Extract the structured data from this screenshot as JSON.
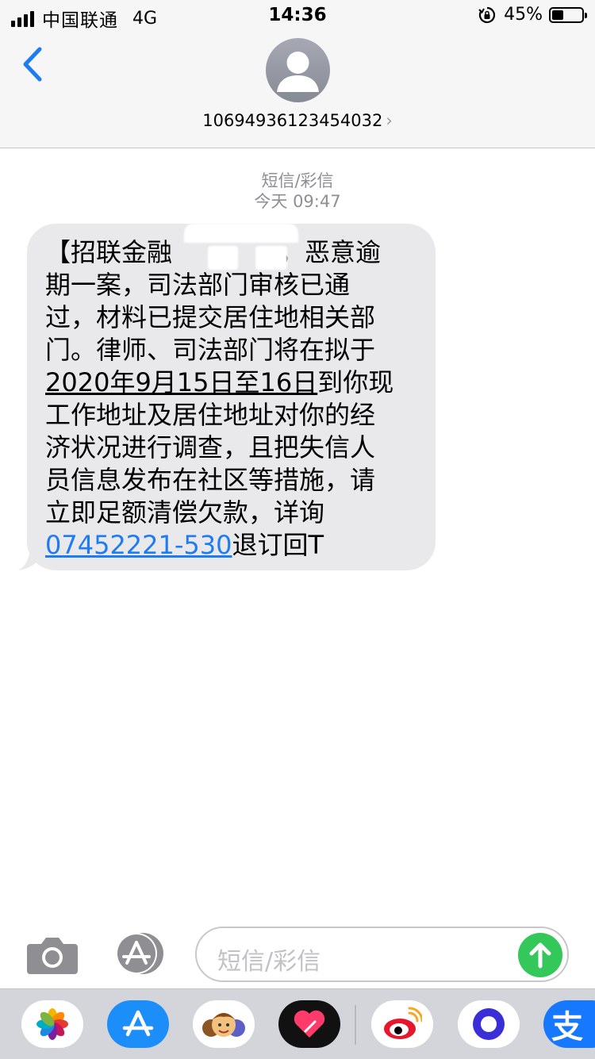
{
  "status_bar": {
    "carrier": "中国联通",
    "network": "4G",
    "time": "14:36",
    "battery": "45%",
    "battery_level": 0.45
  },
  "header": {
    "back_icon": "chevron-left-icon",
    "avatar_icon": "person-icon",
    "contact": "10694936123454032",
    "contact_chevron": "›"
  },
  "conversation": {
    "type_label": "短信/彩信",
    "timestamp": "今天 09:47",
    "message": {
      "line1": "【招联金融",
      "line1_tail": "，恶意逾",
      "line2": "期一案，司法部门审核已通",
      "line3": "过，材料已提交居住地相关部",
      "line4": "门。律师、司法部门将在拟于",
      "line5_underlined": "2020年9月15日至16日",
      "line5_tail": "到你现",
      "line6": "工作地址及居住地址对你的经",
      "line7": "济状况进行调查，且把失信人",
      "line8": "员信息发布在社区等措施，请",
      "line9": "立即足额清偿欠款，详询",
      "phone_link": "07452221-530",
      "line10_tail": "退订回T"
    }
  },
  "input_bar": {
    "camera_icon": "camera-icon",
    "apps_icon": "app-store-icon",
    "placeholder": "短信/彩信",
    "send_icon": "arrow-up-icon",
    "send_color": "#34c759"
  },
  "app_strip": {
    "apps": [
      {
        "name": "photos-app-icon"
      },
      {
        "name": "app-store-app-icon"
      },
      {
        "name": "memoji-app-icon"
      },
      {
        "name": "digital-touch-app-icon"
      },
      {
        "name": "weibo-app-icon"
      },
      {
        "name": "blue-circle-app-icon"
      },
      {
        "name": "alipay-app-icon"
      }
    ],
    "alipay_glyph": "支"
  }
}
